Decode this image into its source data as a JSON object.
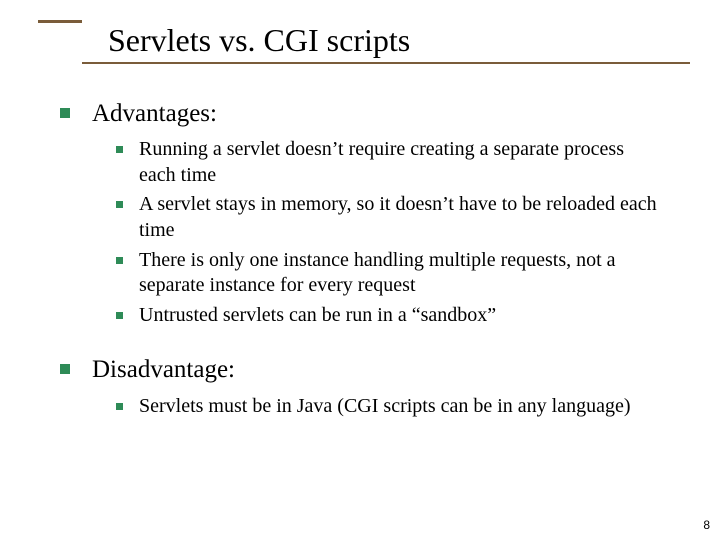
{
  "title": "Servlets vs. CGI scripts",
  "sections": [
    {
      "heading": "Advantages:",
      "items": [
        "Running a servlet doesn’t require creating a separate process each time",
        "A servlet stays in memory, so it doesn’t have to be reloaded each time",
        "There is only one instance handling multiple requests, not a separate instance for every request",
        "Untrusted servlets can be run in a “sandbox”"
      ]
    },
    {
      "heading": "Disadvantage:",
      "items": [
        "Servlets must be in Java (CGI scripts can be in any language)"
      ]
    }
  ],
  "page_number": "8",
  "colors": {
    "bullet": "#2e8b57",
    "rule": "#7a5c3a"
  }
}
